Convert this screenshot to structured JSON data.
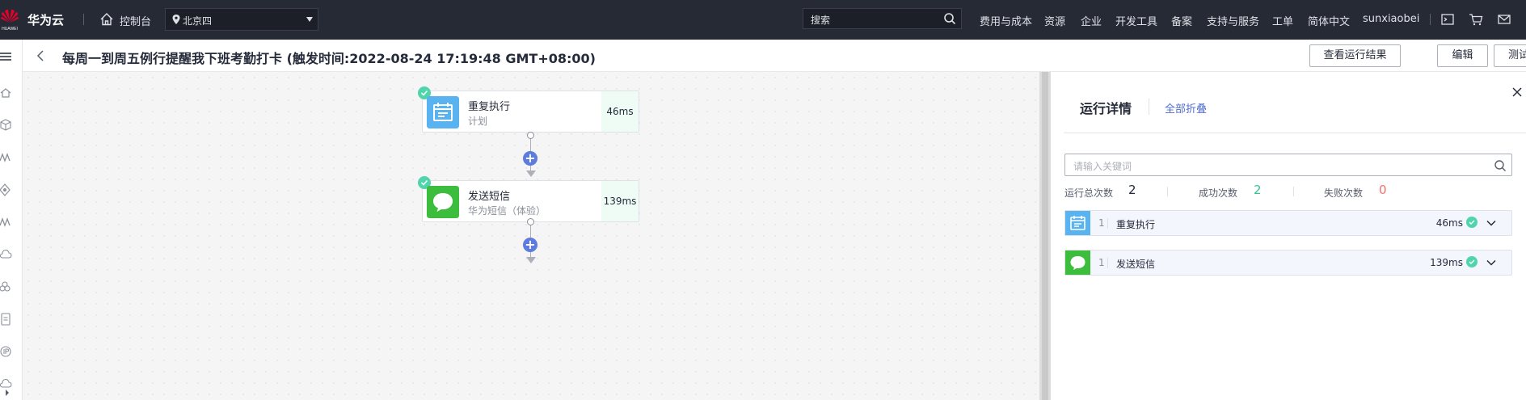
{
  "topbar": {
    "logo_text": "HUAWEI",
    "brand": "华为云",
    "console": "控制台",
    "region": "北京四",
    "search_placeholder": "搜索",
    "nav": [
      "费用与成本",
      "资源",
      "企业",
      "开发工具",
      "备案",
      "支持与服务",
      "工单",
      "简体中文",
      "sunxiaobei"
    ],
    "colors": {
      "bg": "#252a35",
      "logo": "#e4002b"
    }
  },
  "rail": {
    "icons": [
      "menu-icon",
      "home-icon",
      "cube-icon",
      "wave-icon",
      "diamond-icon",
      "wave-icon",
      "cloud-icon",
      "cloud-group-icon",
      "document-icon",
      "ip-icon",
      "cloud-icon"
    ]
  },
  "header": {
    "title": "每周一到周五例行提醒我下班考勤打卡 (触发时间:2022-08-24 17:19:48 GMT+08:00)",
    "buttons": {
      "view_results": "查看运行结果",
      "edit": "编辑",
      "test": "测试"
    }
  },
  "flow": {
    "nodes": [
      {
        "name": "重复执行",
        "sub": "计划",
        "time": "46ms",
        "icon": "calendar-icon",
        "color": "#5ab3f1"
      },
      {
        "name": "发送短信",
        "sub": "华为短信（体验）",
        "time": "139ms",
        "icon": "chat-icon",
        "color": "#3dbd3d"
      }
    ],
    "colors": {
      "plus": "#5e7ce0",
      "success": "#50d4ab"
    }
  },
  "panel": {
    "title": "运行详情",
    "collapse_all": "全部折叠",
    "search_placeholder": "请输入关键词",
    "stats": {
      "total_label": "运行总次数",
      "total": "2",
      "success_label": "成功次数",
      "success": "2",
      "fail_label": "失败次数",
      "fail": "0"
    },
    "rows": [
      {
        "num": "1",
        "name": "重复执行",
        "time": "46ms",
        "icon": "calendar-icon"
      },
      {
        "num": "1",
        "name": "发送短信",
        "time": "139ms",
        "icon": "chat-icon"
      }
    ]
  }
}
